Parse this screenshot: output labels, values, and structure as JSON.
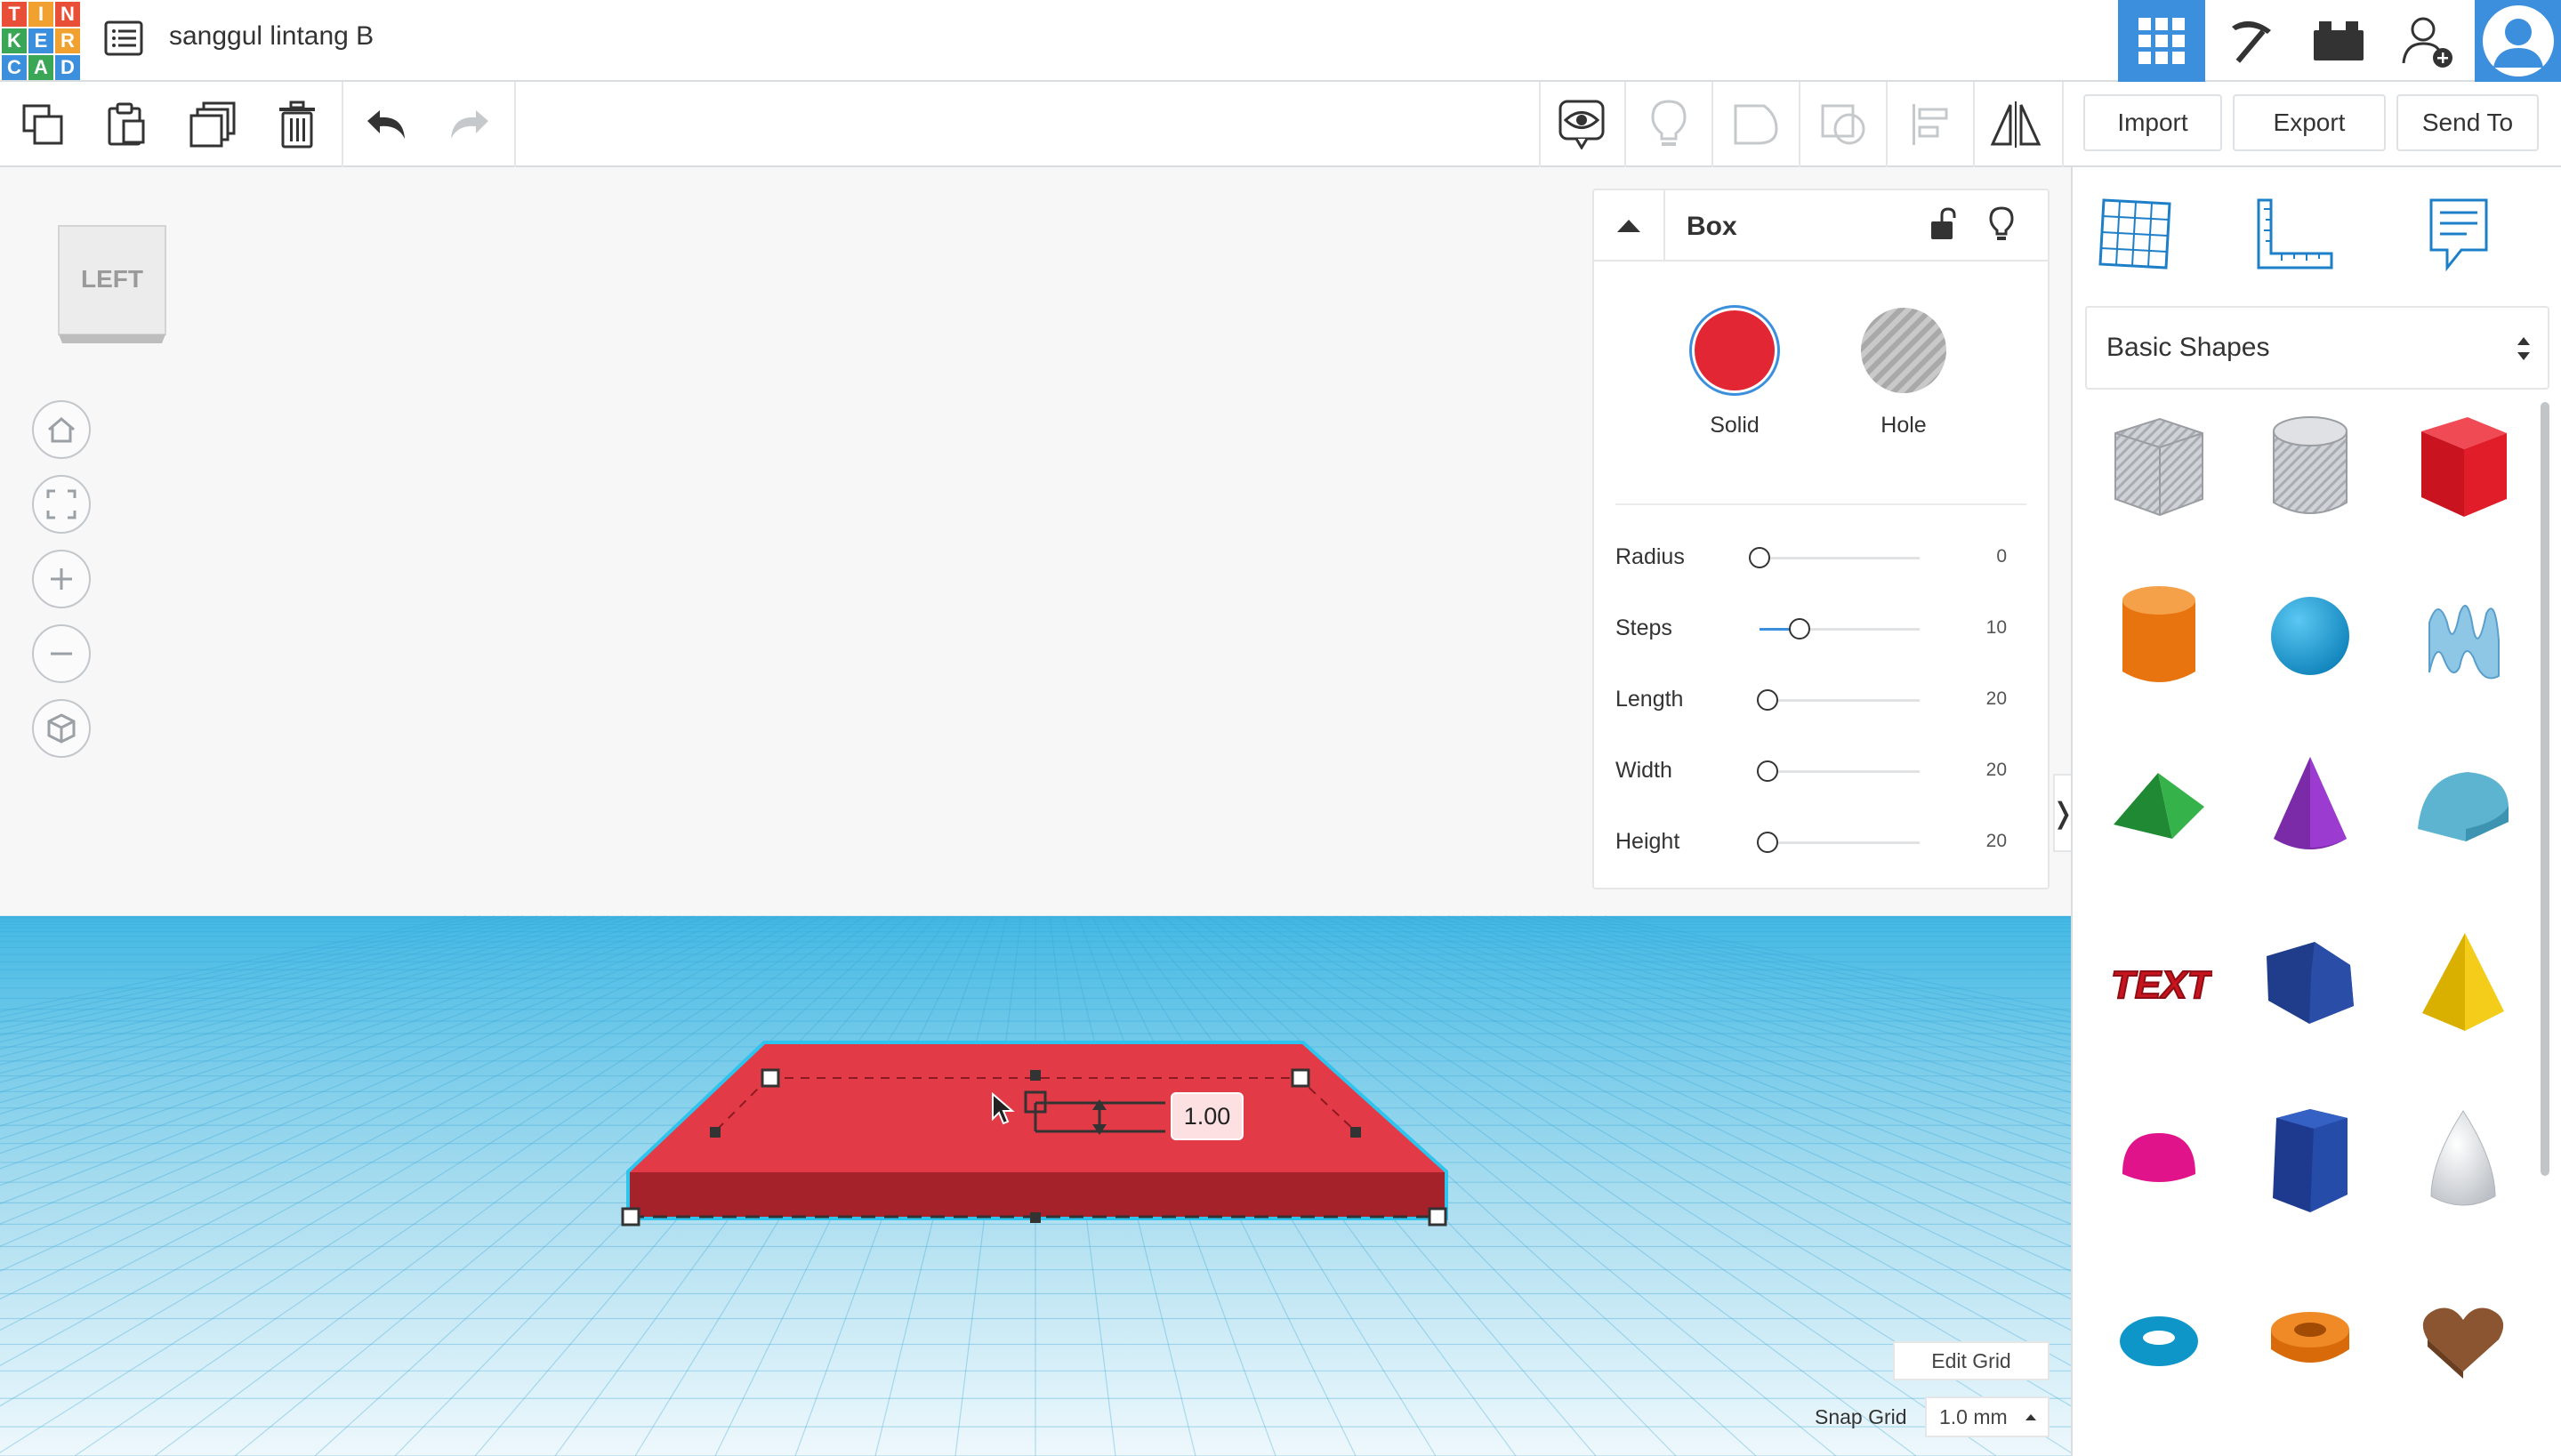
{
  "app": {
    "logo_letters": [
      "T",
      "I",
      "N",
      "K",
      "E",
      "R",
      "C",
      "A",
      "D"
    ],
    "logo_colors": [
      "#e94f37",
      "#f0a12f",
      "#e94f37",
      "#3aa757",
      "#3b8fdc",
      "#f0a12f",
      "#3b8fdc",
      "#3aa757",
      "#3b8fdc"
    ],
    "project_title": "sanggul lintang B"
  },
  "header": {
    "icons": [
      "grid-view-icon",
      "pickaxe-icon",
      "brick-icon",
      "add-user-icon",
      "user-avatar-icon"
    ],
    "accent_color": "#3b8fdc"
  },
  "toolbar": {
    "import_label": "Import",
    "export_label": "Export",
    "send_to_label": "Send To"
  },
  "viewcube": {
    "face_label": "LEFT"
  },
  "inspector": {
    "shape_name": "Box",
    "solid_label": "Solid",
    "hole_label": "Hole",
    "solid_color": "#e32633",
    "properties": [
      {
        "label": "Radius",
        "value": "0",
        "fraction": 0.0
      },
      {
        "label": "Steps",
        "value": "10",
        "fraction": 0.25
      },
      {
        "label": "Length",
        "value": "20",
        "fraction": 0.05
      },
      {
        "label": "Width",
        "value": "20",
        "fraction": 0.05
      },
      {
        "label": "Height",
        "value": "20",
        "fraction": 0.05
      }
    ]
  },
  "workplane": {
    "dimension_value": "1.00",
    "edit_grid_label": "Edit Grid",
    "snap_grid_label": "Snap Grid",
    "snap_grid_value": "1.0 mm"
  },
  "shapes_panel": {
    "library": "Basic Shapes",
    "shapes": [
      "box-hole-shape",
      "cylinder-hole-shape",
      "box-shape",
      "cylinder-shape",
      "sphere-shape",
      "scribble-shape",
      "roof-shape",
      "cone-shape",
      "round-roof-shape",
      "text-shape",
      "polygon-shape",
      "pyramid-shape",
      "half-sphere-shape",
      "hexagonal-prism-shape",
      "paraboloid-shape",
      "torus-shape",
      "tube-shape",
      "heart-shape"
    ]
  }
}
